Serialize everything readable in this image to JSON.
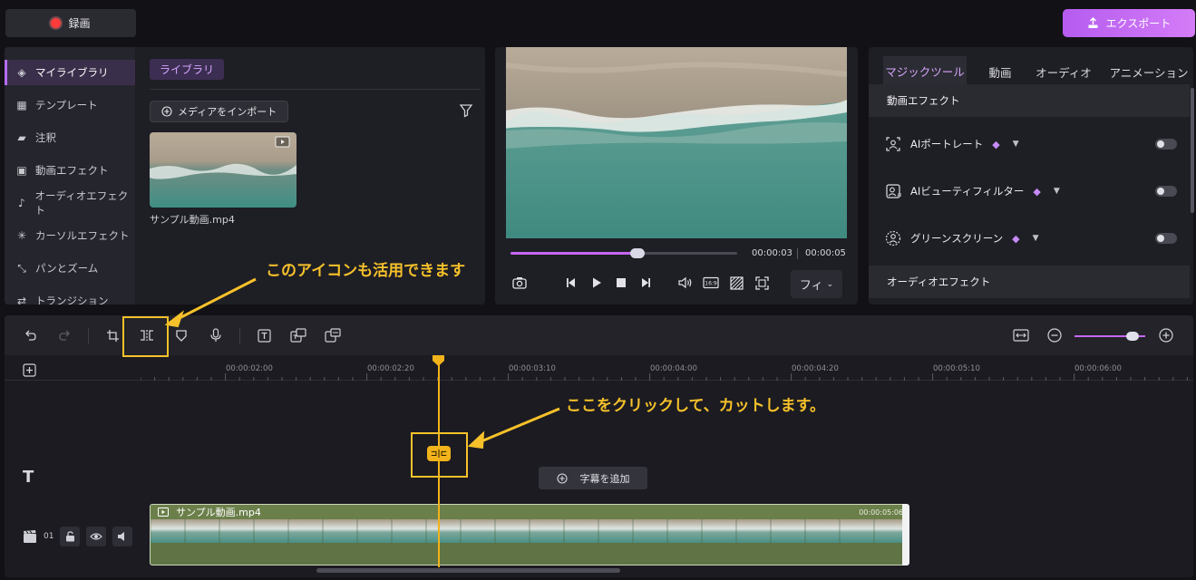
{
  "header": {
    "record_label": "録画",
    "export_label": "エクスポート"
  },
  "sidebar": {
    "items": [
      {
        "label": "マイライブラリ",
        "icon": "layers-icon"
      },
      {
        "label": "テンプレート",
        "icon": "template-icon"
      },
      {
        "label": "注釈",
        "icon": "comment-icon"
      },
      {
        "label": "動画エフェクト",
        "icon": "video-effect-icon"
      },
      {
        "label": "オーディオエフェクト",
        "icon": "music-note-icon"
      },
      {
        "label": "カーソルエフェクト",
        "icon": "cursor-icon"
      },
      {
        "label": "パンとズーム",
        "icon": "pan-zoom-icon"
      },
      {
        "label": "トランジション",
        "icon": "transition-icon"
      }
    ]
  },
  "library": {
    "tab_label": "ライブラリ",
    "import_label": "メディアをインポート",
    "media": [
      {
        "name": "サンプル動画.mp4"
      }
    ]
  },
  "preview": {
    "current_time": "00:00:03",
    "total_time": "00:00:05",
    "progress": 0.56,
    "fit_label": "フィ"
  },
  "right_panel": {
    "tabs": [
      "マジックツール",
      "動画",
      "オーディオ",
      "アニメーション"
    ],
    "video_effects_header": "動画エフェクト",
    "effects": [
      {
        "label": "AIポートレート",
        "enabled": false
      },
      {
        "label": "AIビューティフィルター",
        "enabled": false
      },
      {
        "label": "グリーンスクリーン",
        "enabled": false
      }
    ],
    "audio_effects_header": "オーディオエフェクト"
  },
  "timeline": {
    "ruler_ticks": [
      "00:00:02:00",
      "00:00:02:20",
      "00:00:03:10",
      "00:00:04:00",
      "00:00:04:20",
      "00:00:05:10",
      "00:00:06:00"
    ],
    "add_subtitle_label": "字幕を追加",
    "track_number": "01",
    "clip_name": "サンプル動画.mp4",
    "clip_duration": "00:00:05:06",
    "split_chip_label": "⊐|⊏"
  },
  "annotations": {
    "toolbar_note": "このアイコンも活用できます",
    "playhead_note": "ここをクリックして、カットします。"
  },
  "colors": {
    "accent": "#b56cf5",
    "annotation": "#f6c12a",
    "playhead": "#f2b31b",
    "clip": "#5f7344"
  }
}
